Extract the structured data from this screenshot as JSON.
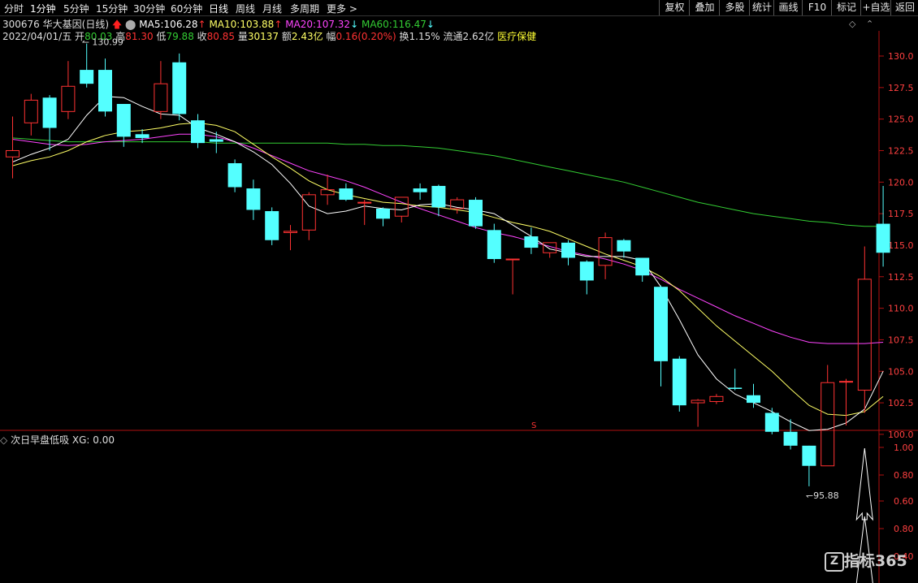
{
  "toolbar": {
    "left": [
      "分时",
      "1分钟",
      "5分钟",
      "15分钟",
      "30分钟",
      "60分钟",
      "日线",
      "周线",
      "月线",
      "多周期",
      "更多 >"
    ],
    "right": [
      "复权",
      "叠加",
      "多股",
      "统计",
      "画线",
      "F10",
      "标记",
      "+自选",
      "返回"
    ]
  },
  "header": {
    "code": "300676",
    "name": "华大基因",
    "period": "(日线)",
    "ma5_label": "MA5:",
    "ma5": "106.28",
    "ma10_label": "MA10:",
    "ma10": "103.88",
    "ma20_label": "MA20:",
    "ma20": "107.32",
    "ma60_label": "MA60:",
    "ma60": "116.47"
  },
  "info": {
    "date": "2022/04/01/五",
    "open_label": "开",
    "open": "80.03",
    "high_label": "高",
    "high": "81.30",
    "low_label": "低",
    "low": "79.88",
    "close_label": "收",
    "close": "80.85",
    "vol_label": "量",
    "vol": "30137",
    "amount_label": "额",
    "amount": "2.43亿",
    "change_label": "幅",
    "change": "0.16(0.20%)",
    "turnover_label": "换",
    "turnover": "1.15%",
    "float_label": "流通",
    "float": "2.62亿",
    "sector": "医疗保健"
  },
  "price_axis": {
    "ticks": [
      "130.0",
      "127.5",
      "125.0",
      "122.5",
      "120.0",
      "117.5",
      "115.0",
      "112.5",
      "110.0",
      "107.5",
      "105.0",
      "102.5",
      "100.0"
    ]
  },
  "annotations": {
    "high_mark": "130.99",
    "low_mark": "95.88",
    "marker": "S"
  },
  "indicator": {
    "name": "次日早盘低吸",
    "xg_label": "XG:",
    "xg_value": "0.00",
    "ticks": [
      "1.00",
      "0.80",
      "0.60",
      "0.80",
      "0.40"
    ]
  },
  "watermark": "指标365",
  "colors": {
    "up": "#ff3232",
    "down": "#54ffff",
    "ma5": "#ffffff",
    "ma10": "#ffff66",
    "ma20": "#ff44ff",
    "ma60": "#33cc33",
    "border": "#b01010",
    "axis_text": "#ff4040"
  },
  "chart_data": {
    "type": "candlestick",
    "y_range": [
      93.0,
      132.0
    ],
    "candles": [
      {
        "o": 122.0,
        "h": 125.2,
        "l": 120.3,
        "c": 122.5
      },
      {
        "o": 124.7,
        "h": 127.0,
        "l": 123.7,
        "c": 126.5
      },
      {
        "o": 126.7,
        "h": 126.9,
        "l": 122.5,
        "c": 124.3
      },
      {
        "o": 125.6,
        "h": 129.6,
        "l": 125.0,
        "c": 127.6
      },
      {
        "o": 128.9,
        "h": 130.99,
        "l": 127.5,
        "c": 127.8
      },
      {
        "o": 128.9,
        "h": 129.8,
        "l": 125.2,
        "c": 125.6
      },
      {
        "o": 126.2,
        "h": 126.2,
        "l": 122.8,
        "c": 123.6
      },
      {
        "o": 123.8,
        "h": 124.2,
        "l": 123.1,
        "c": 123.5
      },
      {
        "o": 125.6,
        "h": 129.6,
        "l": 125.0,
        "c": 127.8
      },
      {
        "o": 129.5,
        "h": 130.2,
        "l": 124.9,
        "c": 125.4
      },
      {
        "o": 124.9,
        "h": 125.4,
        "l": 122.7,
        "c": 123.1
      },
      {
        "o": 123.4,
        "h": 124.0,
        "l": 122.3,
        "c": 123.2
      },
      {
        "o": 121.5,
        "h": 121.8,
        "l": 119.2,
        "c": 119.6
      },
      {
        "o": 119.5,
        "h": 120.2,
        "l": 117.0,
        "c": 117.8
      },
      {
        "o": 117.7,
        "h": 118.0,
        "l": 115.0,
        "c": 115.4
      },
      {
        "o": 116.0,
        "h": 116.6,
        "l": 114.6,
        "c": 116.1
      },
      {
        "o": 116.2,
        "h": 119.2,
        "l": 115.4,
        "c": 119.0
      },
      {
        "o": 119.0,
        "h": 120.6,
        "l": 118.2,
        "c": 119.4
      },
      {
        "o": 119.5,
        "h": 119.9,
        "l": 118.5,
        "c": 118.6
      },
      {
        "o": 118.4,
        "h": 118.6,
        "l": 116.6,
        "c": 118.4
      },
      {
        "o": 117.9,
        "h": 118.0,
        "l": 116.5,
        "c": 117.1
      },
      {
        "o": 117.3,
        "h": 118.8,
        "l": 116.8,
        "c": 118.8
      },
      {
        "o": 119.5,
        "h": 119.9,
        "l": 118.6,
        "c": 119.2
      },
      {
        "o": 119.7,
        "h": 119.8,
        "l": 117.3,
        "c": 118.0
      },
      {
        "o": 117.9,
        "h": 118.8,
        "l": 117.5,
        "c": 118.6
      },
      {
        "o": 118.6,
        "h": 118.8,
        "l": 116.3,
        "c": 116.5
      },
      {
        "o": 116.2,
        "h": 116.7,
        "l": 113.6,
        "c": 113.9
      },
      {
        "o": 113.9,
        "h": 113.9,
        "l": 111.1,
        "c": 113.9
      },
      {
        "o": 115.7,
        "h": 116.4,
        "l": 114.3,
        "c": 114.8
      },
      {
        "o": 114.4,
        "h": 115.2,
        "l": 114.0,
        "c": 115.2
      },
      {
        "o": 115.2,
        "h": 115.4,
        "l": 113.4,
        "c": 114.0
      },
      {
        "o": 113.7,
        "h": 113.8,
        "l": 111.1,
        "c": 112.2
      },
      {
        "o": 113.4,
        "h": 116.0,
        "l": 112.3,
        "c": 115.6
      },
      {
        "o": 115.4,
        "h": 115.5,
        "l": 114.0,
        "c": 114.5
      },
      {
        "o": 114.0,
        "h": 114.0,
        "l": 112.1,
        "c": 112.6
      },
      {
        "o": 111.7,
        "h": 111.8,
        "l": 103.8,
        "c": 105.8
      },
      {
        "o": 106.0,
        "h": 106.2,
        "l": 101.8,
        "c": 102.3
      },
      {
        "o": 102.5,
        "h": 102.8,
        "l": 100.6,
        "c": 102.7
      },
      {
        "o": 102.6,
        "h": 103.2,
        "l": 102.4,
        "c": 103.0
      },
      {
        "o": 103.7,
        "h": 105.2,
        "l": 103.5,
        "c": 103.6
      },
      {
        "o": 103.1,
        "h": 104.0,
        "l": 102.1,
        "c": 102.5
      },
      {
        "o": 101.7,
        "h": 102.1,
        "l": 100.0,
        "c": 100.2
      },
      {
        "o": 100.2,
        "h": 101.2,
        "l": 98.8,
        "c": 99.1
      },
      {
        "o": 99.1,
        "h": 99.1,
        "l": 95.88,
        "c": 97.5
      },
      {
        "o": 97.5,
        "h": 105.5,
        "l": 97.5,
        "c": 104.1
      },
      {
        "o": 104.2,
        "h": 104.4,
        "l": 100.7,
        "c": 104.2
      },
      {
        "o": 103.5,
        "h": 114.9,
        "l": 101.7,
        "c": 112.3
      },
      {
        "o": 116.7,
        "h": 119.7,
        "l": 113.3,
        "c": 114.4
      }
    ],
    "ma5": [
      121.6,
      122.2,
      122.7,
      123.4,
      125.3,
      126.8,
      126.7,
      126.0,
      125.4,
      125.3,
      124.3,
      123.8,
      123.2,
      122.4,
      121.4,
      119.9,
      118.1,
      117.5,
      117.7,
      118.1,
      117.9,
      117.8,
      118.2,
      118.3,
      118.0,
      117.8,
      117.5,
      116.6,
      115.7,
      114.7,
      114.4,
      114.1,
      114.1,
      114.1,
      113.8,
      111.7,
      109.1,
      106.3,
      104.4,
      103.2,
      102.5,
      101.8,
      101.0,
      100.3,
      100.4,
      100.9,
      102.0,
      105.0
    ],
    "ma10": [
      121.3,
      121.7,
      122.0,
      122.5,
      123.2,
      123.7,
      124.0,
      124.1,
      124.3,
      124.6,
      124.7,
      124.5,
      124.0,
      123.0,
      122.0,
      121.1,
      120.1,
      119.4,
      119.0,
      118.7,
      118.4,
      118.3,
      118.1,
      118.0,
      117.8,
      117.6,
      117.2,
      116.8,
      116.5,
      116.1,
      115.5,
      114.9,
      114.3,
      113.8,
      113.3,
      112.5,
      111.4,
      110.0,
      108.6,
      107.4,
      106.2,
      105.0,
      103.6,
      102.3,
      101.6,
      101.5,
      101.8,
      103.0
    ],
    "ma20": [
      123.4,
      123.2,
      123.0,
      122.9,
      123.0,
      123.2,
      123.3,
      123.4,
      123.6,
      123.8,
      123.8,
      123.6,
      123.2,
      122.7,
      122.1,
      121.5,
      120.9,
      120.5,
      120.1,
      119.6,
      119.0,
      118.4,
      117.9,
      117.4,
      116.9,
      116.4,
      116.0,
      115.7,
      115.3,
      114.9,
      114.5,
      114.2,
      113.9,
      113.5,
      113.0,
      112.3,
      111.5,
      110.8,
      110.1,
      109.4,
      108.8,
      108.2,
      107.7,
      107.3,
      107.2,
      107.2,
      107.2,
      107.3
    ],
    "ma60": [
      123.5,
      123.4,
      123.3,
      123.2,
      123.2,
      123.2,
      123.2,
      123.2,
      123.2,
      123.2,
      123.2,
      123.1,
      123.1,
      123.1,
      123.1,
      123.1,
      123.1,
      123.1,
      123.0,
      123.0,
      122.9,
      122.9,
      122.8,
      122.7,
      122.5,
      122.3,
      122.1,
      121.8,
      121.5,
      121.2,
      120.9,
      120.6,
      120.3,
      120.0,
      119.6,
      119.2,
      118.8,
      118.4,
      118.1,
      117.8,
      117.5,
      117.3,
      117.1,
      116.9,
      116.8,
      116.6,
      116.5,
      116.5
    ],
    "xg": [
      0,
      0,
      0,
      0,
      0,
      0,
      0,
      0,
      0,
      0,
      0,
      0,
      0,
      0,
      0,
      0,
      0,
      0,
      0,
      0,
      0,
      0,
      0,
      0,
      0,
      0,
      0,
      0,
      0,
      0,
      0,
      0,
      0,
      0,
      0,
      0,
      0,
      0,
      0,
      0,
      0,
      0,
      0,
      0,
      0,
      0,
      1,
      0
    ]
  }
}
